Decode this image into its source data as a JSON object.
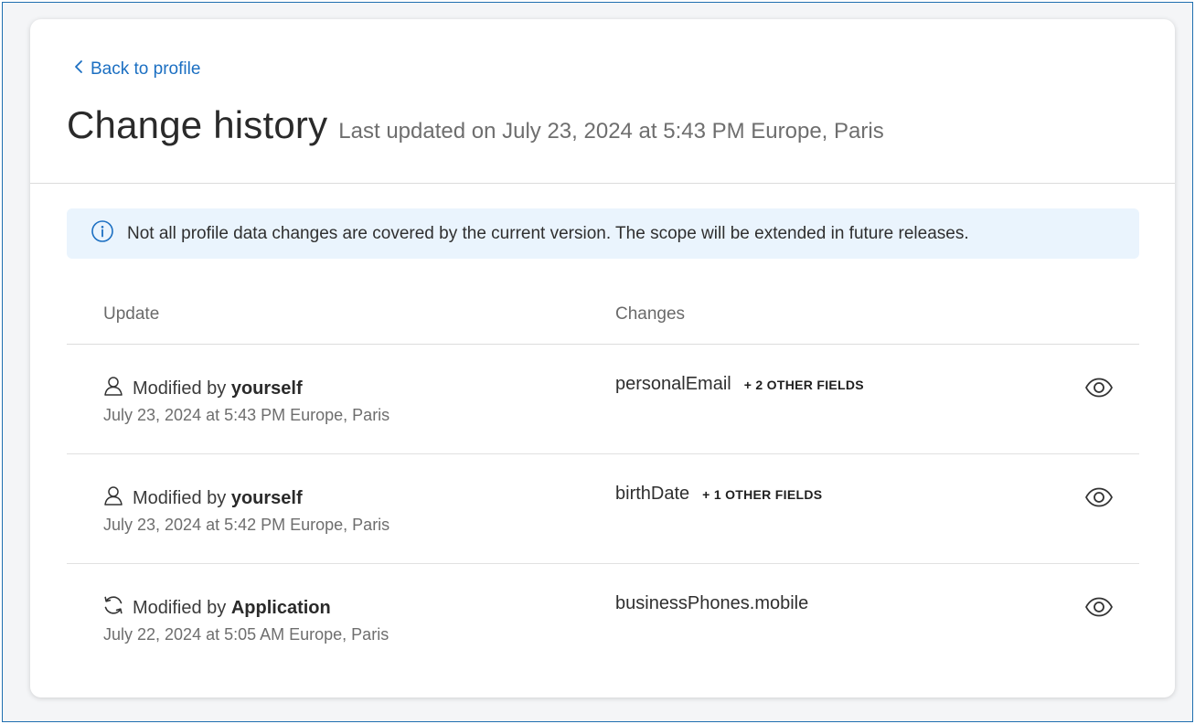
{
  "header": {
    "back_label": "Back to profile",
    "title": "Change history",
    "last_updated": "Last updated on July 23, 2024 at 5:43 PM Europe, Paris"
  },
  "banner": {
    "icon": "info-icon",
    "text": "Not all profile data changes are covered by the current version. The scope will be extended in future releases."
  },
  "table": {
    "columns": {
      "update": "Update",
      "changes": "Changes"
    },
    "rows": [
      {
        "icon": "user-icon",
        "prefix": "Modified by ",
        "actor": "yourself",
        "date": "July 23, 2024 at 5:43 PM Europe, Paris",
        "field": "personalEmail",
        "more": "+ 2 OTHER FIELDS"
      },
      {
        "icon": "user-icon",
        "prefix": "Modified by ",
        "actor": "yourself",
        "date": "July 23, 2024 at 5:42 PM Europe, Paris",
        "field": "birthDate",
        "more": "+ 1 OTHER FIELDS"
      },
      {
        "icon": "sync-icon",
        "prefix": "Modified by ",
        "actor": "Application",
        "date": "July 22, 2024 at 5:05 AM Europe, Paris",
        "field": "businessPhones.mobile",
        "more": ""
      }
    ]
  },
  "colors": {
    "accent": "#1b6fc2",
    "banner_bg": "#eaf4fd",
    "frame_border": "#1f6fb0"
  }
}
